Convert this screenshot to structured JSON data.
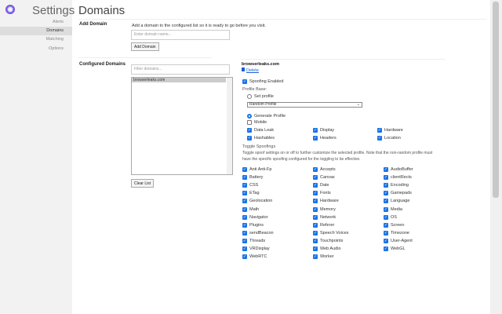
{
  "sidebar": {
    "title": "Settings",
    "items": [
      {
        "label": "Alerts"
      },
      {
        "label": "Domains",
        "active": true
      },
      {
        "label": "Matching"
      },
      {
        "label": "Options"
      }
    ]
  },
  "page_title": "Domains",
  "add_domain": {
    "heading": "Add Domain",
    "description": "Add a domain to the configured list so it is ready to go before you visit.",
    "placeholder": "Enter domain name...",
    "button": "Add Domain"
  },
  "configured": {
    "heading": "Configured Domains",
    "filter_placeholder": "Filter domains...",
    "domains": [
      "browserleaks.com"
    ],
    "clear_button": "Clear List"
  },
  "detail": {
    "domain": "browserleaks.com",
    "delete": "Delete",
    "spoofing_enabled": "Spoofing Enabled",
    "profile_base": "Profile Base:",
    "set_profile": "Set profile",
    "select_value": "Random Profile",
    "generate_profile": "Generate Profile",
    "mobile": "Mobile",
    "generate_options": [
      {
        "label": "Data Leak"
      },
      {
        "label": "Display"
      },
      {
        "label": "Hardware"
      },
      {
        "label": "Hashables"
      },
      {
        "label": "Headers"
      },
      {
        "label": "Location"
      }
    ],
    "toggle_heading": "Toggle Spoofings",
    "toggle_desc1": "Toggle spoof settings on or off to further customize the selected profile. Note that the non-random profile must",
    "toggle_desc2": "have the specific spoofing configured for the toggling to be effective.",
    "toggles": [
      "Anti Anti-Fp",
      "Accepts",
      "AudioBuffer",
      "Battery",
      "Canvas",
      "clientRects",
      "CSS",
      "Date",
      "Encoding",
      "ETag",
      "Fonts",
      "Gamepads",
      "Geolocation",
      "Hardware",
      "Language",
      "Math",
      "Memory",
      "Media",
      "Navigator",
      "Network",
      "OS",
      "Plugins",
      "Referer",
      "Screen",
      "sendBeacon",
      "Speech Voices",
      "Timezone",
      "Threads",
      "Touchpoints",
      "User-Agent",
      "VRDisplay",
      "Web Audio",
      "WebGL",
      "WebRTC",
      "Worker"
    ]
  },
  "colors": {
    "accent": "#1a73e8"
  }
}
